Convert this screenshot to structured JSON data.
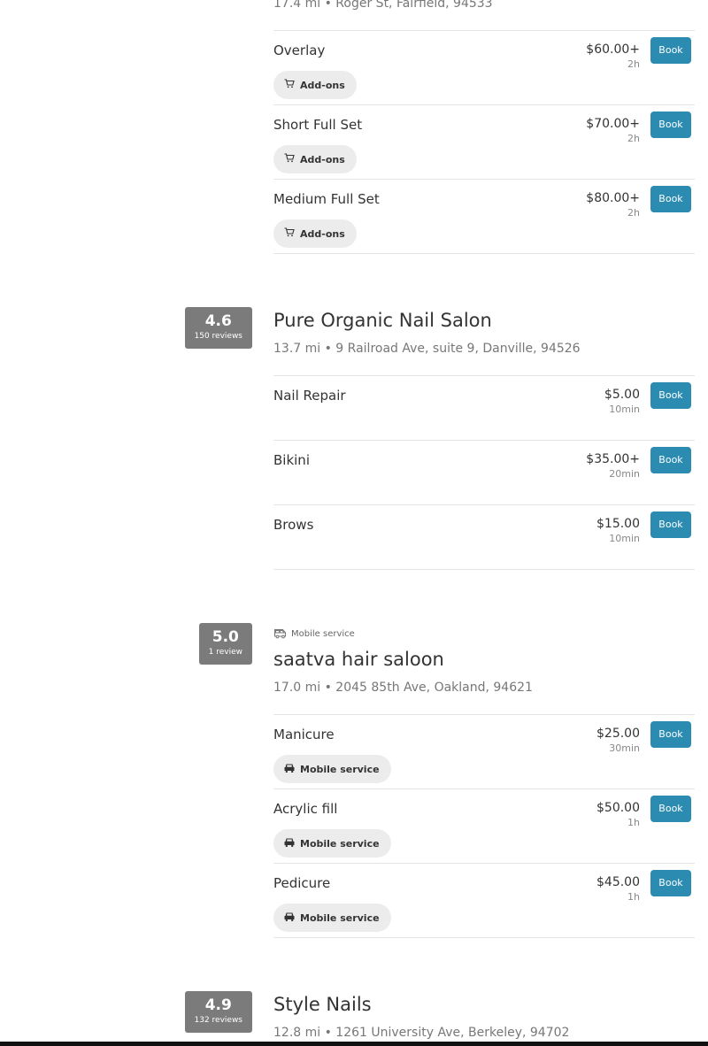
{
  "listings": [
    {
      "address": "17.4 mi • Roger St, Fairfield, 94533",
      "services": [
        {
          "name": "Overlay",
          "price": "$60.00+",
          "duration": "2h",
          "chip": "Add-ons",
          "book": "Book"
        },
        {
          "name": "Short Full Set",
          "price": "$70.00+",
          "duration": "2h",
          "chip": "Add-ons",
          "book": "Book"
        },
        {
          "name": "Medium Full Set",
          "price": "$80.00+",
          "duration": "2h",
          "chip": "Add-ons",
          "book": "Book"
        }
      ]
    },
    {
      "rating": "4.6",
      "reviews": "150 reviews",
      "name": "Pure Organic Nail Salon",
      "address": "13.7 mi • 9 Railroad Ave, suite 9, Danville, 94526",
      "services": [
        {
          "name": "Nail Repair",
          "price": "$5.00",
          "duration": "10min",
          "book": "Book"
        },
        {
          "name": "Bikini",
          "price": "$35.00+",
          "duration": "20min",
          "book": "Book"
        },
        {
          "name": "Brows",
          "price": "$15.00",
          "duration": "10min",
          "book": "Book"
        }
      ]
    },
    {
      "rating": "5.0",
      "reviews": "1 review",
      "tag": "Mobile service",
      "name": "saatva hair saloon",
      "address": "17.0 mi • 2045 85th Ave, Oakland, 94621",
      "services": [
        {
          "name": "Manicure",
          "price": "$25.00",
          "duration": "30min",
          "chip": "Mobile service",
          "book": "Book"
        },
        {
          "name": "Acrylic fill",
          "price": "$50.00",
          "duration": "1h",
          "chip": "Mobile service",
          "book": "Book"
        },
        {
          "name": "Pedicure",
          "price": "$45.00",
          "duration": "1h",
          "chip": "Mobile service",
          "book": "Book"
        }
      ]
    },
    {
      "rating": "4.9",
      "reviews": "132 reviews",
      "name": "Style Nails",
      "address": "12.8 mi • 1261 University Ave, Berkeley, 94702"
    }
  ],
  "icons": {
    "addons": "cart-icon",
    "mobile": "car-icon",
    "mobile_tag": "van-icon"
  },
  "colors": {
    "book_button": "#2b8bb1",
    "rating_badge": "#7b7b7b",
    "chip_bg": "#ececec"
  }
}
